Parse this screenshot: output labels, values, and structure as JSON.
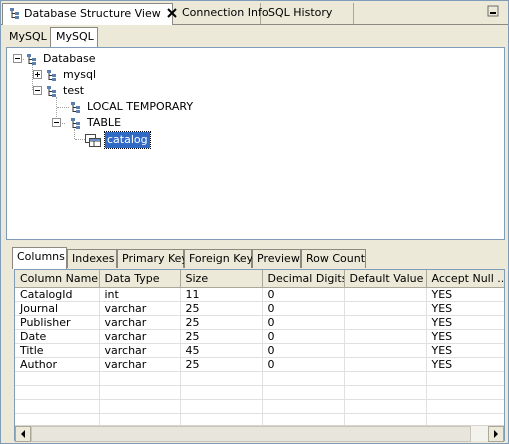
{
  "view_tabs": [
    {
      "label": "Database Structure View"
    },
    {
      "label": "Connection Info"
    },
    {
      "label": "SQL History"
    }
  ],
  "sub_tabs": [
    {
      "label": "MySQL"
    },
    {
      "label": "MySQL"
    }
  ],
  "tree": {
    "root": "Database",
    "items": [
      {
        "label": "mysql"
      },
      {
        "label": "test"
      },
      {
        "label": "LOCAL TEMPORARY"
      },
      {
        "label": "TABLE"
      },
      {
        "label": "catalog"
      }
    ]
  },
  "detail_tabs": [
    {
      "label": "Columns"
    },
    {
      "label": "Indexes"
    },
    {
      "label": "Primary Key"
    },
    {
      "label": "Foreign Key"
    },
    {
      "label": "Preview"
    },
    {
      "label": "Row Count"
    }
  ],
  "table": {
    "headers": [
      "Column Name",
      "Data Type",
      "Size",
      "Decimal Digits",
      "Default Value",
      "Accept Null ..."
    ],
    "rows": [
      [
        "CatalogId",
        "int",
        "11",
        "0",
        "",
        "YES"
      ],
      [
        "Journal",
        "varchar",
        "25",
        "0",
        "",
        "YES"
      ],
      [
        "Publisher",
        "varchar",
        "25",
        "0",
        "",
        "YES"
      ],
      [
        "Date",
        "varchar",
        "25",
        "0",
        "",
        "YES"
      ],
      [
        "Title",
        "varchar",
        "45",
        "0",
        "",
        "YES"
      ],
      [
        "Author",
        "varchar",
        "25",
        "0",
        "",
        "YES"
      ]
    ]
  },
  "colors": {
    "selection": "#316ac5",
    "border": "#7f9db9",
    "chrome": "#ece9d8"
  }
}
